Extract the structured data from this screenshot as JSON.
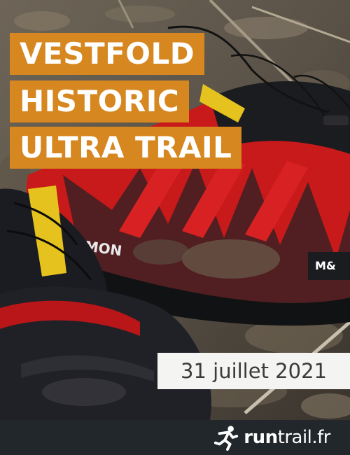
{
  "poster": {
    "title_lines": [
      "VESTFOLD",
      "HISTORIC",
      "ULTRA TRAIL"
    ],
    "date": "31 juillet 2021",
    "shoe_brand_text": "MON",
    "shoe_badge_text": "M&"
  },
  "footer": {
    "brand_bold": "run",
    "brand_light": "trail.fr",
    "logo_icon": "runner-icon"
  },
  "colors": {
    "accent_orange": "#d6871f",
    "footer_bg": "#22272b",
    "shoe_red": "#c8191b",
    "date_bg": "#f4f4f2"
  }
}
